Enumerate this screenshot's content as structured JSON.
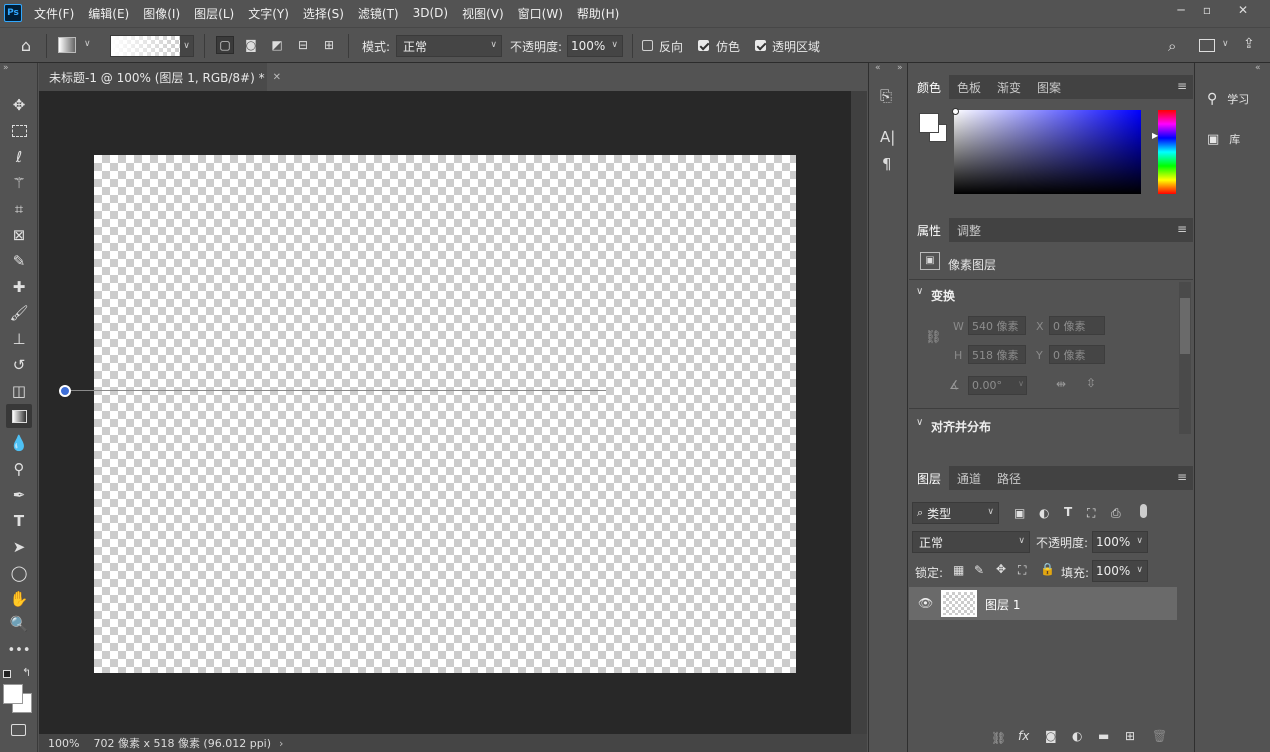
{
  "app": {
    "logo": "Ps"
  },
  "menu": [
    "文件(F)",
    "编辑(E)",
    "图像(I)",
    "图层(L)",
    "文字(Y)",
    "选择(S)",
    "滤镜(T)",
    "3D(D)",
    "视图(V)",
    "窗口(W)",
    "帮助(H)"
  ],
  "options": {
    "mode_label": "模式:",
    "mode_value": "正常",
    "opacity_label": "不透明度:",
    "opacity_value": "100%",
    "reverse_label": "反向",
    "dither_label": "仿色",
    "transparency_label": "透明区域",
    "reverse_checked": false,
    "dither_checked": true,
    "transparency_checked": true
  },
  "document": {
    "tab_title": "未标题-1 @ 100% (图层 1, RGB/8#) *",
    "zoom": "100%",
    "doc_info": "702 像素 x 518 像素 (96.012 ppi)"
  },
  "color_panel": {
    "tabs": [
      "颜色",
      "色板",
      "渐变",
      "图案"
    ],
    "active_tab": "颜色"
  },
  "properties_panel": {
    "tabs": [
      "属性",
      "调整"
    ],
    "layer_type": "像素图层",
    "transform_title": "变换",
    "w_label": "W",
    "w_value": "540 像素",
    "x_label": "X",
    "x_value": "0 像素",
    "h_label": "H",
    "h_value": "518 像素",
    "y_label": "Y",
    "y_value": "0 像素",
    "angle_value": "0.00°",
    "align_title": "对齐并分布"
  },
  "layers_panel": {
    "tabs": [
      "图层",
      "通道",
      "路径"
    ],
    "filter_label": "类型",
    "blend_mode": "正常",
    "opacity_label": "不透明度:",
    "opacity_value": "100%",
    "lock_label": "锁定:",
    "fill_label": "填充:",
    "fill_value": "100%",
    "layers": [
      {
        "name": "图层 1",
        "visible": true,
        "selected": true
      }
    ]
  },
  "right_strip": {
    "learn": "学习",
    "library": "库"
  },
  "colors": {
    "accent": "#31a8ff",
    "panel_bg": "#535353",
    "workspace_bg": "#282828"
  }
}
